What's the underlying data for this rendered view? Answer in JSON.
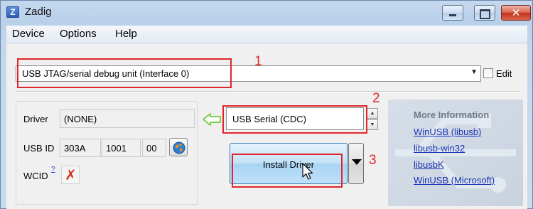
{
  "window": {
    "title": "Zadig",
    "app_icon_letter": "Z"
  },
  "menu": {
    "items": [
      "Device",
      "Options",
      "Help"
    ]
  },
  "device": {
    "selected": "USB JTAG/serial debug unit (Interface 0)",
    "edit_label": "Edit",
    "edit_checked": false
  },
  "driver_panel": {
    "driver_label": "Driver",
    "driver_value": "(NONE)",
    "usbid_label": "USB ID",
    "vid": "303A",
    "pid": "1001",
    "rev": "00",
    "wcid_label": "WCID",
    "wcid_help": "?"
  },
  "target": {
    "value": "USB Serial (CDC)"
  },
  "install": {
    "label": "Install Driver"
  },
  "info": {
    "title": "More Information",
    "links": [
      "WinUSB (libusb)",
      "libusb-win32",
      "libusbK",
      "WinUSB (Microsoft)"
    ]
  },
  "annotations": {
    "labels": [
      "1",
      "2",
      "3"
    ],
    "color": "#e0262a"
  },
  "colors": {
    "link": "#1a33b5",
    "arrow": "#7ccf4f",
    "install_button": "#bfe1f8"
  }
}
